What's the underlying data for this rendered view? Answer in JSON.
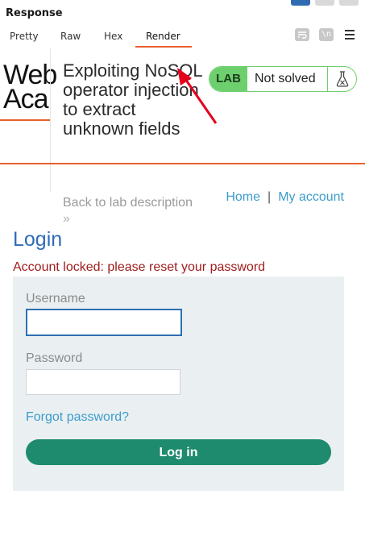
{
  "panel": {
    "title": "Response",
    "tabs": [
      "Pretty",
      "Raw",
      "Hex",
      "Render"
    ],
    "active_tab": "Render",
    "tool_icons": [
      "wrap-lines-icon",
      "newline-icon",
      "menu-icon"
    ],
    "newline_glyph": "\\n"
  },
  "page": {
    "logo_text_line1": "Web",
    "logo_text_line2": "Aca",
    "lab_title": "Exploiting NoSQL operator injection to extract unknown fields",
    "lab_badge_label": "LAB",
    "lab_status": "Not solved",
    "back_link": "Back to lab description",
    "back_chevron": "»",
    "nav": {
      "home": "Home",
      "separator": "|",
      "account": "My account"
    },
    "login_heading": "Login",
    "error_message": "Account locked: please reset your password",
    "username_label": "Username",
    "username_value": "",
    "password_label": "Password",
    "password_value": "",
    "forgot_link": "Forgot password?",
    "login_button": "Log in"
  },
  "colors": {
    "accent_orange": "#e8602c",
    "lab_green": "#6ecf6e",
    "link_blue": "#3d9ccc",
    "heading_blue": "#2e6cb7",
    "error_red": "#a01d1d",
    "button_green": "#1e8a6e",
    "form_bg": "#eaf0f2",
    "annotation_arrow": "#e3001b"
  }
}
